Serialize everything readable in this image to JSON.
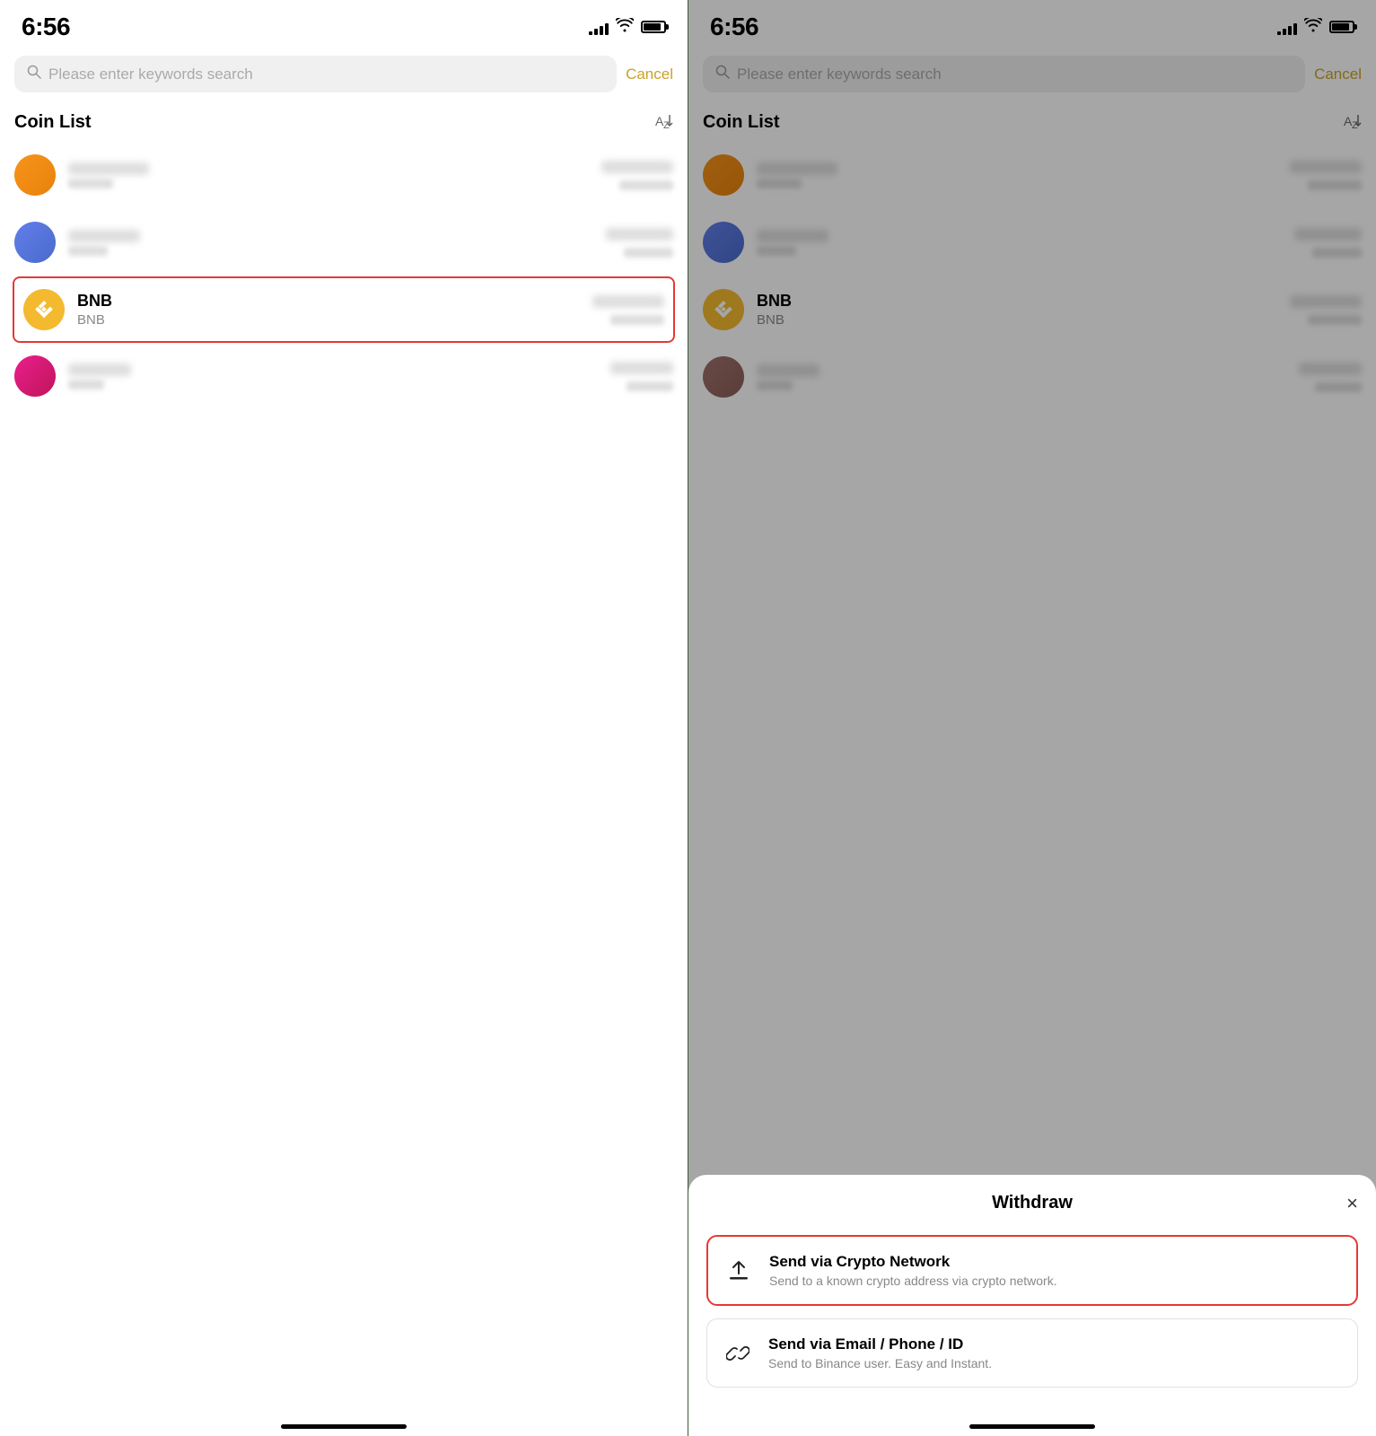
{
  "left_panel": {
    "status": {
      "time": "6:56",
      "signal_bars": [
        3,
        5,
        7,
        9,
        11
      ],
      "wifi": "WiFi",
      "battery": "battery"
    },
    "search": {
      "placeholder": "Please enter keywords search",
      "cancel_label": "Cancel"
    },
    "coin_list": {
      "title": "Coin List",
      "sort_icon": "sort",
      "coins": [
        {
          "id": "coin1",
          "color": "orange",
          "name": "",
          "symbol": "",
          "blurred": true
        },
        {
          "id": "coin2",
          "color": "blue",
          "name": "",
          "symbol": "",
          "blurred": true
        },
        {
          "id": "bnb",
          "color": "bnb",
          "name": "BNB",
          "symbol": "BNB",
          "blurred": false,
          "highlighted": true
        },
        {
          "id": "coin4",
          "color": "pink",
          "name": "",
          "symbol": "",
          "blurred": true
        }
      ]
    },
    "home_indicator": "home"
  },
  "right_panel": {
    "status": {
      "time": "6:56",
      "signal_bars": [
        3,
        5,
        7,
        9,
        11
      ],
      "wifi": "WiFi",
      "battery": "battery"
    },
    "search": {
      "placeholder": "Please enter keywords search",
      "cancel_label": "Cancel"
    },
    "coin_list": {
      "title": "Coin List",
      "sort_icon": "sort",
      "coins": [
        {
          "id": "coin1r",
          "color": "orange",
          "name": "",
          "symbol": "",
          "blurred": true
        },
        {
          "id": "coin2r",
          "color": "blue",
          "name": "",
          "symbol": "",
          "blurred": true
        },
        {
          "id": "bnbr",
          "color": "bnb",
          "name": "BNB",
          "symbol": "BNB",
          "blurred": false,
          "highlighted": false
        },
        {
          "id": "coin4r",
          "color": "pink",
          "name": "",
          "symbol": "",
          "blurred": true
        }
      ]
    },
    "bottom_sheet": {
      "title": "Withdraw",
      "close_label": "×",
      "options": [
        {
          "id": "crypto-network",
          "title": "Send via Crypto Network",
          "description": "Send to a known crypto address via crypto network.",
          "highlighted": true
        },
        {
          "id": "email-phone",
          "title": "Send via Email / Phone / ID",
          "description": "Send to Binance user. Easy and Instant.",
          "highlighted": false
        }
      ]
    },
    "home_indicator": "home"
  }
}
